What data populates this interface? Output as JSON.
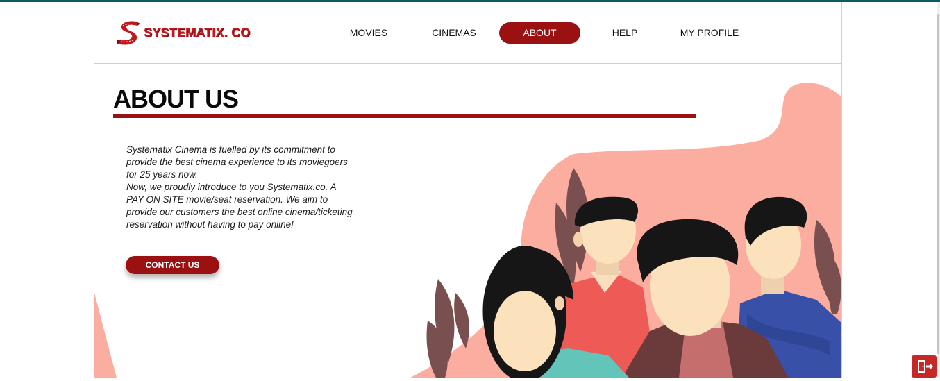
{
  "brand": {
    "name": "SYSTEMATIX. CO"
  },
  "nav": {
    "items": [
      {
        "label": "MOVIES"
      },
      {
        "label": "CINEMAS"
      },
      {
        "label": "ABOUT"
      },
      {
        "label": "HELP"
      },
      {
        "label": "MY PROFILE"
      }
    ],
    "active_index": 2
  },
  "about": {
    "title": "ABOUT US",
    "paragraph1": "Systematix Cinema is fuelled by its commitment to provide the best cinema experience to its moviegoers for 25 years now.",
    "paragraph2": "Now, we proudly introduce to you Systematix.co. A PAY ON SITE movie/seat reservation. We aim to provide our customers the best online cinema/ticketing reservation without having to pay online!",
    "contact_button": "CONTACT US"
  },
  "icons": {
    "logo": "stylized-s-logo",
    "exit": "exit-door-icon"
  },
  "colors": {
    "accent": "#9b1010",
    "brand_text": "#c4161c",
    "top_stripe": "#0b5c5c",
    "blob": "#fbaea0",
    "exit_button": "#c62828"
  }
}
